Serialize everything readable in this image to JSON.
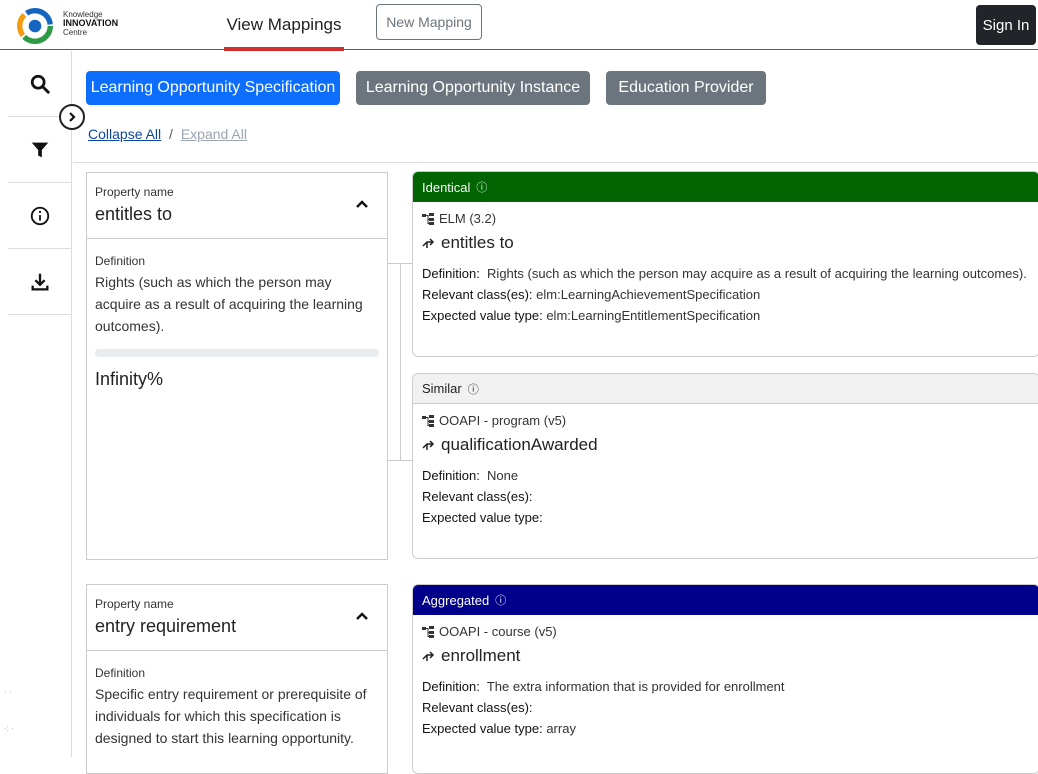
{
  "brand": {
    "line1": "Knowledge",
    "line2": "INNOVATION",
    "line3": "Centre"
  },
  "nav": {
    "view_mappings": "View Mappings",
    "new_mapping": "New Mapping",
    "sign_in": "Sign In"
  },
  "tabs": [
    "Learning Opportunity Specification",
    "Learning Opportunity Instance",
    "Education Provider"
  ],
  "controls": {
    "collapse_all": "Collapse All",
    "separator": "/",
    "expand_all": "Expand All"
  },
  "properties": [
    {
      "label": "Property name",
      "name": "entitles to",
      "def_label": "Definition",
      "definition": "Rights (such as which the person may acquire as a result of acquiring the learning outcomes).",
      "progress_text": "Infinity%"
    },
    {
      "label": "Property name",
      "name": "entry requirement",
      "def_label": "Definition",
      "definition": "Specific entry requirement or prerequisite of individuals for which this specification is designed to start this learning opportunity."
    }
  ],
  "mappings": [
    {
      "type": "Identical",
      "source": "ELM (3.2)",
      "term": "entitles to",
      "definition_label": "Definition:",
      "definition": "Rights (such as which the person may acquire as a result of acquiring the learning outcomes).",
      "classes_label": "Relevant class(es):",
      "classes": "elm:LearningAchievementSpecification",
      "value_label": "Expected value type:",
      "value": "elm:LearningEntitlementSpecification"
    },
    {
      "type": "Similar",
      "source": "OOAPI - program (v5)",
      "term": "qualificationAwarded",
      "definition_label": "Definition:",
      "definition": "None",
      "classes_label": "Relevant class(es):",
      "classes": "",
      "value_label": "Expected value type:",
      "value": ""
    },
    {
      "type": "Aggregated",
      "source": "OOAPI - course (v5)",
      "term": "enrollment",
      "definition_label": "Definition:",
      "definition": "The extra information that is provided for enrollment",
      "classes_label": "Relevant class(es):",
      "classes": "",
      "value_label": "Expected value type:",
      "value": "array"
    }
  ],
  "colors": {
    "identical": "#006400",
    "similar": "#f1f1f1",
    "aggregated": "#00008b",
    "active_tab": "#0d6efd",
    "tab": "#6c757d",
    "accent_red": "#d32f2f"
  },
  "icons": [
    "search-icon",
    "filter-icon",
    "info-icon",
    "download-icon",
    "chevron-right-icon",
    "chevron-up-icon",
    "help-circle-icon",
    "schema-icon",
    "property-arrow-icon"
  ]
}
